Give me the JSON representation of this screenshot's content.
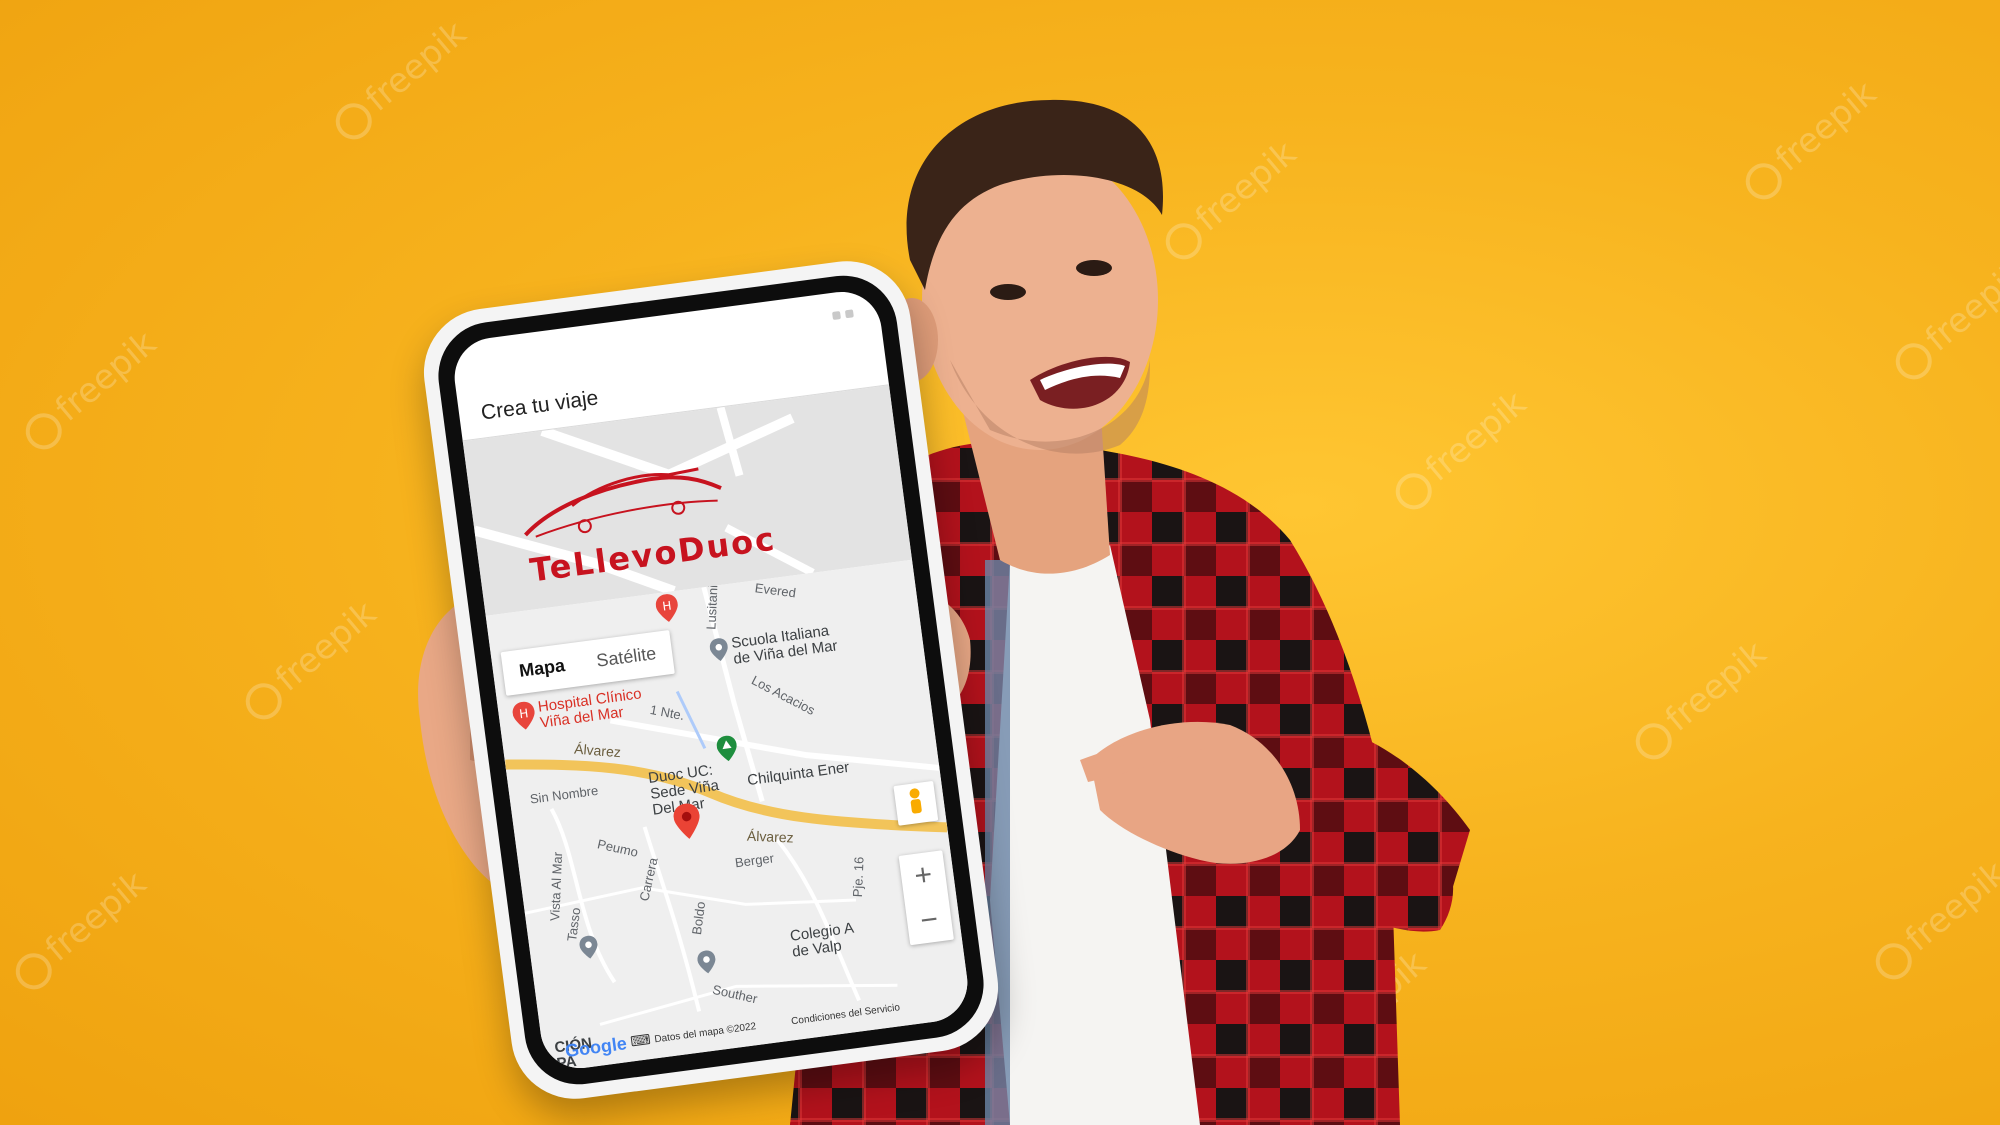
{
  "screen": {
    "title": "Crea tu viaje",
    "logo_text": "TeLlevoDuoc",
    "brand_color": "#C7131F",
    "background_color": "#F7B31E"
  },
  "map": {
    "type_buttons": [
      "Mapa",
      "Satélite"
    ],
    "selected_type": "Mapa",
    "labels": {
      "hospital": "Hospital Clínico",
      "hospital_2": "Viña del Mar",
      "scuola": "Scuola Italiana",
      "scuola_2": "de Viña del Mar",
      "duoc": "Duoc UC:",
      "duoc_2": "Sede Viña",
      "duoc_3": "Del Mar",
      "chilquinta": "Chilquinta Ener",
      "colegio": "Colegio A",
      "colegio_2": "de Valp",
      "alvarez_1": "Álvarez",
      "alvarez_2": "Álvarez",
      "nte": "1 Nte.",
      "lusitania": "Lusitania",
      "evered": "Evered",
      "acacios": "Los Acacios",
      "sin_nombre": "Sin Nombre",
      "peumo": "Peumo",
      "carrera": "Carrera",
      "berger": "Berger",
      "boldo": "Boldo",
      "pje": "Pje. 16",
      "souther": "Souther",
      "tasso": "Tasso",
      "vista": "Vista Al Mar",
      "cion": "CIÓN",
      "pa": "PA"
    },
    "zoom_in": "+",
    "zoom_out": "−",
    "footer": {
      "google": "Google",
      "data": "Datos del mapa ©2022",
      "terms": "Condiciones del Servicio"
    }
  },
  "watermark": "freepik"
}
